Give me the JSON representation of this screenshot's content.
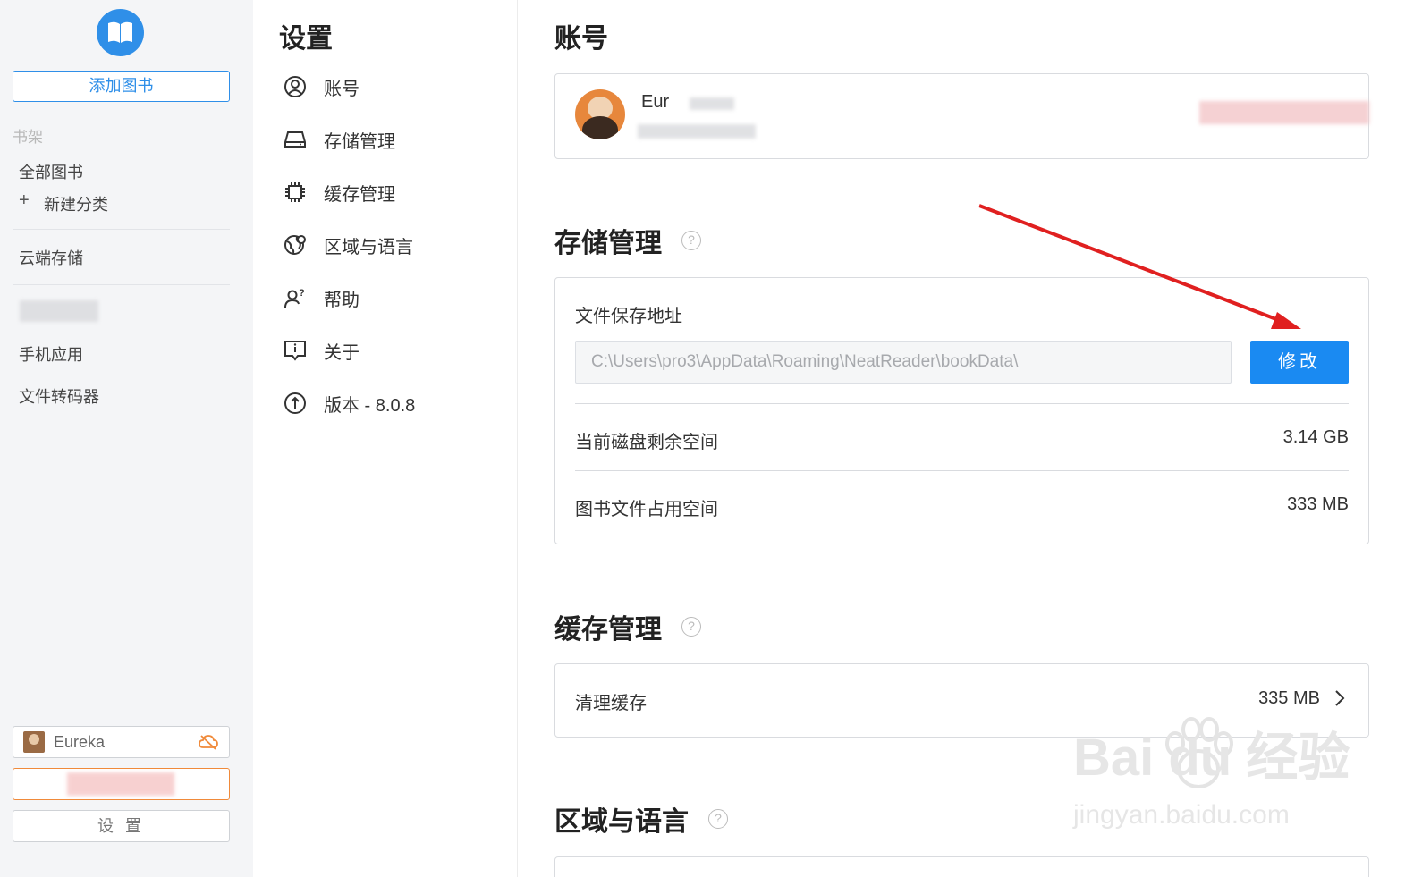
{
  "sidebar": {
    "add_book": "添加图书",
    "shelf_title": "书架",
    "all_books": "全部图书",
    "new_category_plus": "+",
    "new_category": "新建分类",
    "cloud_storage": "云端存储",
    "mobile_app": "手机应用",
    "file_converter": "文件转码器",
    "user_name": "Eureka",
    "settings": "设 置"
  },
  "nav": {
    "title": "设置",
    "items": [
      {
        "label": "账号",
        "icon": "user-circle-icon"
      },
      {
        "label": "存储管理",
        "icon": "hard-drive-icon"
      },
      {
        "label": "缓存管理",
        "icon": "chip-icon"
      },
      {
        "label": "区域与语言",
        "icon": "globe-icon"
      },
      {
        "label": "帮助",
        "icon": "help-person-icon"
      },
      {
        "label": "关于",
        "icon": "info-chat-icon"
      },
      {
        "label": "版本 - 8.0.8",
        "icon": "upgrade-icon"
      }
    ]
  },
  "account": {
    "title": "账号",
    "name": "Eur"
  },
  "storage": {
    "title": "存储管理",
    "help": "?",
    "save_path_label": "文件保存地址",
    "save_path": "C:\\Users\\pro3\\AppData\\Roaming\\NeatReader\\bookData\\",
    "modify": "修改",
    "free_space_label": "当前磁盘剩余空间",
    "free_space_value": "3.14 GB",
    "book_space_label": "图书文件占用空间",
    "book_space_value": "333 MB"
  },
  "cache": {
    "title": "缓存管理",
    "help": "?",
    "clear_label": "清理缓存",
    "clear_value": "335 MB"
  },
  "region": {
    "title": "区域与语言",
    "help": "?"
  },
  "watermark": {
    "main": "Bai du 经验",
    "sub": "jingyan.baidu.com"
  },
  "colors": {
    "accent": "#1a8af2",
    "warning_orange": "#f08a3a",
    "annotation_arrow": "#e02020"
  }
}
